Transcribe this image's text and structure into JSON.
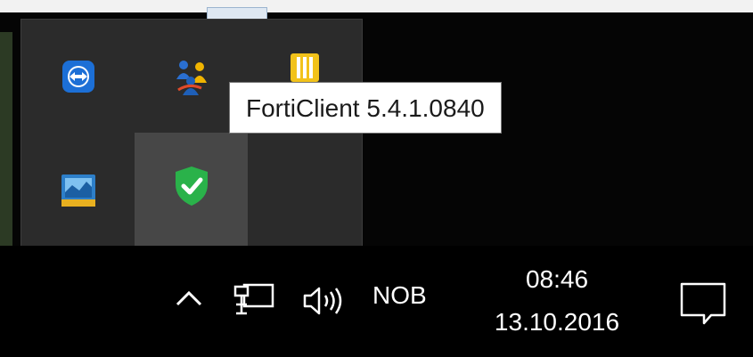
{
  "tooltip": {
    "text": "FortiClient 5.4.1.0840"
  },
  "tray_overflow": {
    "icons": [
      "teamviewer-icon",
      "network-people-icon",
      "yellow-app-icon",
      "intel-graphics-icon",
      "forticlient-shield-icon"
    ],
    "hovered_icon": "forticlient-shield-icon"
  },
  "taskbar": {
    "show_hidden_icons": "chevron-up-icon",
    "network_icon": "ethernet-icon",
    "volume_icon": "speaker-icon",
    "language": "NOB",
    "clock": {
      "time": "08:46",
      "date": "13.10.2016"
    },
    "action_center": "notification-icon"
  },
  "colors": {
    "flyout_bg": "#2b2b2b",
    "hover_bg": "#474747",
    "taskbar_bg": "#000000",
    "shield_green": "#2ab24a"
  }
}
